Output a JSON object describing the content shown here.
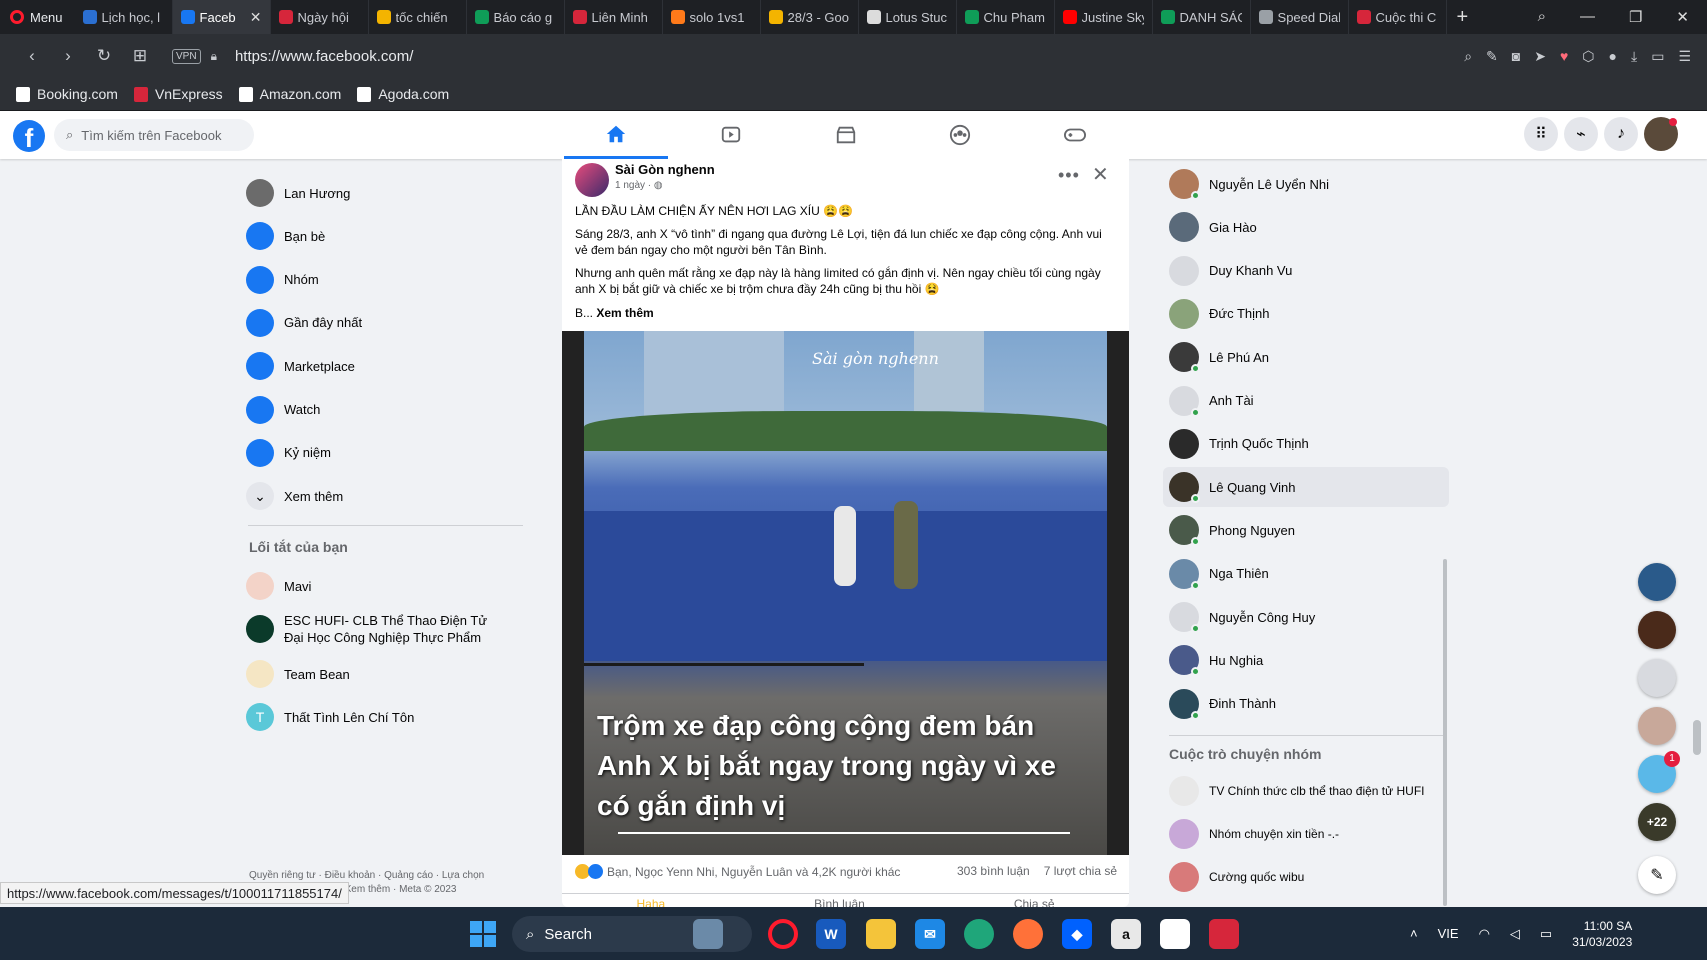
{
  "browser": {
    "menu_label": "Menu",
    "tabs": [
      {
        "label": "Lịch học, l",
        "color": "#2b6fd1",
        "active": false
      },
      {
        "label": "Faceb",
        "color": "#1877f2",
        "active": true
      },
      {
        "label": "Ngày hội",
        "color": "#d6263b",
        "active": false
      },
      {
        "label": "tốc chiến",
        "color": "#f4b400",
        "active": false
      },
      {
        "label": "Báo cáo g",
        "color": "#0f9d58",
        "active": false
      },
      {
        "label": "Liên Minh",
        "color": "#d6263b",
        "active": false
      },
      {
        "label": "solo 1vs1",
        "color": "#ff7a1a",
        "active": false
      },
      {
        "label": "28/3 - Goo",
        "color": "#f4b400",
        "active": false
      },
      {
        "label": "Lotus Stuc",
        "color": "#dcdcdc",
        "active": false
      },
      {
        "label": "Chu Pham",
        "color": "#0f9d58",
        "active": false
      },
      {
        "label": "Justine Sky",
        "color": "#ff0000",
        "active": false
      },
      {
        "label": "DANH SÁC",
        "color": "#0f9d58",
        "active": false
      },
      {
        "label": "Speed Dial",
        "color": "#9aa0a6",
        "active": false
      },
      {
        "label": "Cuộc thi C",
        "color": "#d6263b",
        "active": false
      }
    ],
    "url": "https://www.facebook.com/",
    "vpn_label": "VPN",
    "bookmarks": [
      {
        "label": "Booking.com",
        "color": "#ffffff"
      },
      {
        "label": "VnExpress",
        "color": "#d6263b"
      },
      {
        "label": "Amazon.com",
        "color": "#ffffff"
      },
      {
        "label": "Agoda.com",
        "color": "#ffffff"
      }
    ],
    "status_url": "https://www.facebook.com/messages/t/100011711855174/"
  },
  "facebook": {
    "search_placeholder": "Tìm kiếm trên Facebook",
    "left_nav": [
      {
        "label": "Lan Hương",
        "icon": "profile-avatar",
        "color": "#6b6b6b"
      },
      {
        "label": "Bạn bè",
        "icon": "friends-icon",
        "color": "#1877f2"
      },
      {
        "label": "Nhóm",
        "icon": "groups-icon",
        "color": "#1877f2"
      },
      {
        "label": "Gần đây nhất",
        "icon": "recent-icon",
        "color": "#1877f2"
      },
      {
        "label": "Marketplace",
        "icon": "marketplace-icon",
        "color": "#1877f2"
      },
      {
        "label": "Watch",
        "icon": "watch-icon",
        "color": "#1877f2"
      },
      {
        "label": "Kỷ niệm",
        "icon": "memories-icon",
        "color": "#1877f2"
      },
      {
        "label": "Xem thêm",
        "icon": "chevron-down-icon",
        "color": "#e4e6eb"
      }
    ],
    "shortcuts_heading": "Lối tắt của bạn",
    "shortcuts": [
      {
        "label": "Mavi",
        "color": "#f3d3c8"
      },
      {
        "label": "ESC HUFI- CLB Thể Thao Điện Tử Đại Học Công Nghiệp Thực Phẩm",
        "color": "#0b3a2a"
      },
      {
        "label": "Team Bean",
        "color": "#f5e6c4"
      },
      {
        "label": "Thất Tình Lên Chí Tôn",
        "color": "#5ac8d8",
        "initial": "T"
      }
    ],
    "footer": "Quyền riêng tư · Điều khoản · Quảng cáo · Lựa chọn quảng cáo · Cookie · Xem thêm · Meta © 2023",
    "post": {
      "author": "Sài Gòn nghenn",
      "time": "1 ngày ·",
      "headline": "LẦN ĐẦU LÀM CHIỆN ẤY NÊN HƠI LAG XÍU 😩😩",
      "paragraph1": "Sáng 28/3, anh X “vô tình” đi ngang qua đường Lê Lợi, tiện đá lun chiếc xe đạp công cộng. Anh vui vẻ đem bán ngay cho một người bên Tân Bình.",
      "paragraph2": "Nhưng anh quên mất rằng xe đạp này là hàng limited có gắn định vị. Nên ngay chiều tối cùng ngày anh X bị bắt giữ và chiếc xe bị trộm chưa đầy 24h cũng bị thu hồi 😫",
      "see_more_prefix": "B...",
      "see_more": "Xem thêm",
      "image_caption": "Trộm xe đạp công cộng đem bán Anh X bị bắt ngay trong ngày vì xe có gắn định vị",
      "watermark": "Sài gòn nghenn",
      "reactions_text": "Bạn, Ngọc Yenn Nhi, Nguyễn Luân và 4,2K người khác",
      "comments": "303 bình luận",
      "shares": "7 lượt chia sẻ",
      "actions": [
        "Haha",
        "Bình luận",
        "Chia sẻ"
      ]
    },
    "contacts": [
      {
        "name": "Nguyễn Lê Uyển Nhi",
        "color": "#b07a5a",
        "online": true
      },
      {
        "name": "Gia Hào",
        "color": "#5a6a7a",
        "online": false
      },
      {
        "name": "Duy Khanh Vu",
        "color": "#d8dadf",
        "online": false
      },
      {
        "name": "Đức Thịnh",
        "color": "#8aa37a",
        "online": false
      },
      {
        "name": "Lê Phú An",
        "color": "#3a3a3a",
        "online": true
      },
      {
        "name": "Anh Tài",
        "color": "#d8dadf",
        "online": true
      },
      {
        "name": "Trịnh Quốc Thịnh",
        "color": "#2a2a2a",
        "online": false
      },
      {
        "name": "Lê Quang Vinh",
        "color": "#3a3328",
        "online": true
      },
      {
        "name": "Phong Nguyen",
        "color": "#4a5a4a",
        "online": true
      },
      {
        "name": "Nga Thiên",
        "color": "#6a8aa8",
        "online": true
      },
      {
        "name": "Nguyễn Công Huy",
        "color": "#d8dadf",
        "online": true
      },
      {
        "name": "Hu Nghia",
        "color": "#4a5a8a",
        "online": true
      },
      {
        "name": "Đinh Thành",
        "color": "#2a4a5a",
        "online": true
      }
    ],
    "group_chats_heading": "Cuộc trò chuyện nhóm",
    "group_chats": [
      {
        "name": "TV Chính thức clb thể thao điện tử HUFI",
        "color": "#e8e8e8"
      },
      {
        "name": "Nhóm chuyện xin tiền -.-",
        "color": "#c8a8d8"
      },
      {
        "name": "Cường quốc wibu",
        "color": "#d87a7a"
      }
    ],
    "chat_bubbles": [
      {
        "color": "#2a5a8a",
        "badge": ""
      },
      {
        "color": "#4a2a1a",
        "badge": ""
      },
      {
        "color": "#d8dadf",
        "badge": ""
      },
      {
        "color": "#c8a89a",
        "badge": ""
      },
      {
        "color": "#5ab8e8",
        "badge": "1"
      },
      {
        "color": "#3a3a2a",
        "badge": "",
        "count": "+22"
      }
    ]
  },
  "taskbar": {
    "search_label": "Search",
    "language": "VIE",
    "time": "11:00 SA",
    "date": "31/03/2023"
  }
}
